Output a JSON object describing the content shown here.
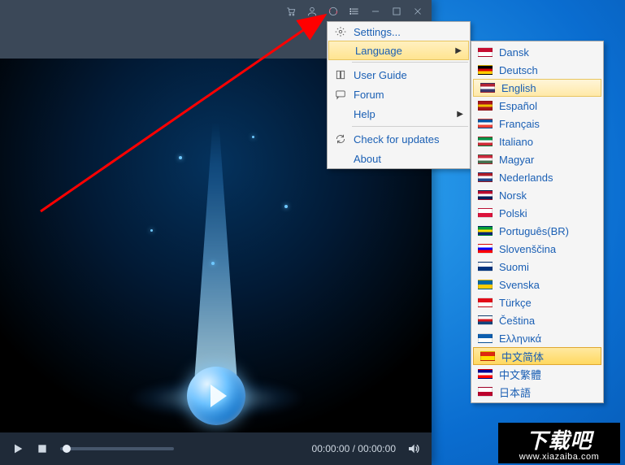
{
  "titlebar": {
    "icons": [
      "cart",
      "user",
      "headset",
      "menu-list",
      "minimize",
      "maximize",
      "close"
    ]
  },
  "player": {
    "time_current": "00:00:00",
    "time_total": "00:00:00",
    "time_separator": " / "
  },
  "menu": {
    "items": [
      {
        "icon": "gear",
        "label": "Settings...",
        "submenu": false
      },
      {
        "icon": "",
        "label": "Language",
        "submenu": true,
        "highlighted": true
      },
      {
        "sep": true
      },
      {
        "icon": "book",
        "label": "User Guide",
        "submenu": false
      },
      {
        "icon": "chat",
        "label": "Forum",
        "submenu": false
      },
      {
        "icon": "",
        "label": "Help",
        "submenu": true
      },
      {
        "sep": true
      },
      {
        "icon": "refresh",
        "label": "Check for updates",
        "submenu": false
      },
      {
        "icon": "",
        "label": "About",
        "submenu": false
      }
    ]
  },
  "languages": [
    {
      "label": "Dansk",
      "flag_colors": [
        "#c60c30",
        "#ffffff"
      ]
    },
    {
      "label": "Deutsch",
      "flag_colors": [
        "#000000",
        "#dd0000",
        "#ffce00"
      ]
    },
    {
      "label": "English",
      "flag_colors": [
        "#b22234",
        "#ffffff",
        "#3c3b6e"
      ],
      "selected": true
    },
    {
      "label": "Español",
      "flag_colors": [
        "#aa151b",
        "#f1bf00",
        "#aa151b"
      ]
    },
    {
      "label": "Français",
      "flag_colors": [
        "#0055a4",
        "#ffffff",
        "#ef4135"
      ]
    },
    {
      "label": "Italiano",
      "flag_colors": [
        "#009246",
        "#ffffff",
        "#ce2b37"
      ]
    },
    {
      "label": "Magyar",
      "flag_colors": [
        "#cd2a3e",
        "#ffffff",
        "#436f4d"
      ]
    },
    {
      "label": "Nederlands",
      "flag_colors": [
        "#ae1c28",
        "#ffffff",
        "#21468b"
      ]
    },
    {
      "label": "Norsk",
      "flag_colors": [
        "#ba0c2f",
        "#ffffff",
        "#00205b"
      ]
    },
    {
      "label": "Polski",
      "flag_colors": [
        "#ffffff",
        "#dc143c"
      ]
    },
    {
      "label": "Português(BR)",
      "flag_colors": [
        "#009b3a",
        "#fedf00",
        "#002776"
      ]
    },
    {
      "label": "Slovenščina",
      "flag_colors": [
        "#ffffff",
        "#0000ff",
        "#ff0000"
      ]
    },
    {
      "label": "Suomi",
      "flag_colors": [
        "#ffffff",
        "#003580"
      ]
    },
    {
      "label": "Svenska",
      "flag_colors": [
        "#006aa7",
        "#fecc00"
      ]
    },
    {
      "label": "Türkçe",
      "flag_colors": [
        "#e30a17",
        "#ffffff"
      ]
    },
    {
      "label": "Čeština",
      "flag_colors": [
        "#ffffff",
        "#d7141a",
        "#11457e"
      ]
    },
    {
      "label": "Ελληνικά",
      "flag_colors": [
        "#0d5eaf",
        "#ffffff"
      ]
    },
    {
      "label": "中文简体",
      "flag_colors": [
        "#de2910",
        "#ffde00"
      ],
      "hover": true
    },
    {
      "label": "中文繁體",
      "flag_colors": [
        "#000095",
        "#ffffff",
        "#fe0000"
      ]
    },
    {
      "label": "日本語",
      "flag_colors": [
        "#ffffff",
        "#bc002d"
      ]
    }
  ],
  "watermark": {
    "text": "下载吧",
    "url": "www.xiazaiba.com"
  }
}
